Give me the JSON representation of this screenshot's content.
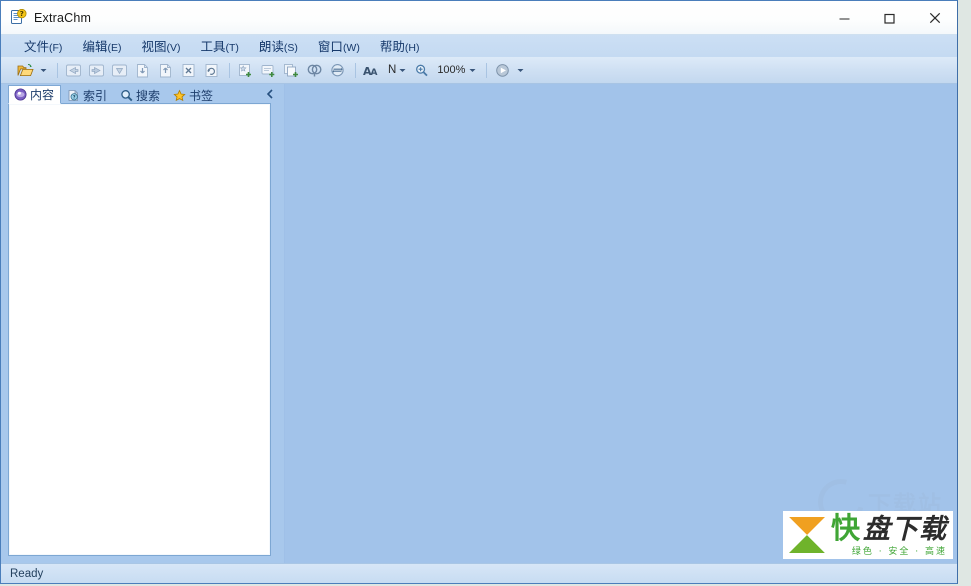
{
  "window": {
    "title": "ExtraChm",
    "app_icon": "chm-help-document-icon",
    "controls": {
      "minimize": "–",
      "maximize": "□",
      "close": "✕"
    }
  },
  "menubar": {
    "items": [
      {
        "label": "文件",
        "mnemonic": "(F)",
        "name": "menu-file"
      },
      {
        "label": "编辑",
        "mnemonic": "(E)",
        "name": "menu-edit"
      },
      {
        "label": "视图",
        "mnemonic": "(V)",
        "name": "menu-view"
      },
      {
        "label": "工具",
        "mnemonic": "(T)",
        "name": "menu-tools"
      },
      {
        "label": "朗读",
        "mnemonic": "(S)",
        "name": "menu-speech"
      },
      {
        "label": "窗口",
        "mnemonic": "(W)",
        "name": "menu-window"
      },
      {
        "label": "帮助",
        "mnemonic": "(H)",
        "name": "menu-help"
      }
    ]
  },
  "toolbar": {
    "open_icon": "open-folder-icon",
    "open_dropdown_icon": "chevron-down-icon",
    "back_icon": "navigate-back-icon",
    "forward_icon": "navigate-forward-icon",
    "down_icon": "navigate-down-icon",
    "prev_page_icon": "previous-page-icon",
    "next_page_icon": "next-page-icon",
    "close_page_icon": "close-page-icon",
    "refresh_page_icon": "refresh-page-icon",
    "bookmark_add_icon": "add-bookmark-icon",
    "note_add_icon": "add-note-icon",
    "copy_page_icon": "copy-page-icon",
    "find_icon": "find-magnifier-icon",
    "sync_icon": "sync-toc-icon",
    "font_icon": "font-size-icon",
    "font_label": "N",
    "font_dropdown_icon": "chevron-down-icon",
    "zoom_icon": "zoom-magnifier-icon",
    "zoom_value": "100%",
    "zoom_dropdown_icon": "chevron-down-icon",
    "play_icon": "play-read-aloud-icon",
    "play_dropdown_icon": "chevron-down-icon"
  },
  "sidebar": {
    "tabs": [
      {
        "label": "内容",
        "icon": "contents-book-icon",
        "active": true,
        "name": "tab-contents"
      },
      {
        "label": "索引",
        "icon": "index-icon",
        "active": false,
        "name": "tab-index"
      },
      {
        "label": "搜索",
        "icon": "search-magnifier-icon",
        "active": false,
        "name": "tab-search"
      },
      {
        "label": "书签",
        "icon": "bookmark-star-icon",
        "active": false,
        "name": "tab-bookmarks"
      }
    ],
    "collapse_icon": "collapse-left-chevron-icon",
    "tree_items": []
  },
  "content": {
    "body_text": ""
  },
  "statusbar": {
    "text": "Ready"
  },
  "watermark": {
    "faint_text": "下载站",
    "brand_kuai": "快",
    "brand_pan": "盘下载",
    "brand_sub": "绿色 · 安全 · 高速"
  },
  "colors": {
    "window_border": "#4a7ebb",
    "menubar_bg": "#c8dcf3",
    "toolbar_bg": "#cfe0f3",
    "content_bg": "#a2c3ea",
    "tab_active_bg": "#ffffff",
    "tree_bg": "#ffffff",
    "status_bg": "#cfe1f4",
    "brand_green": "#3fa535",
    "brand_orange": "#f0a020"
  }
}
